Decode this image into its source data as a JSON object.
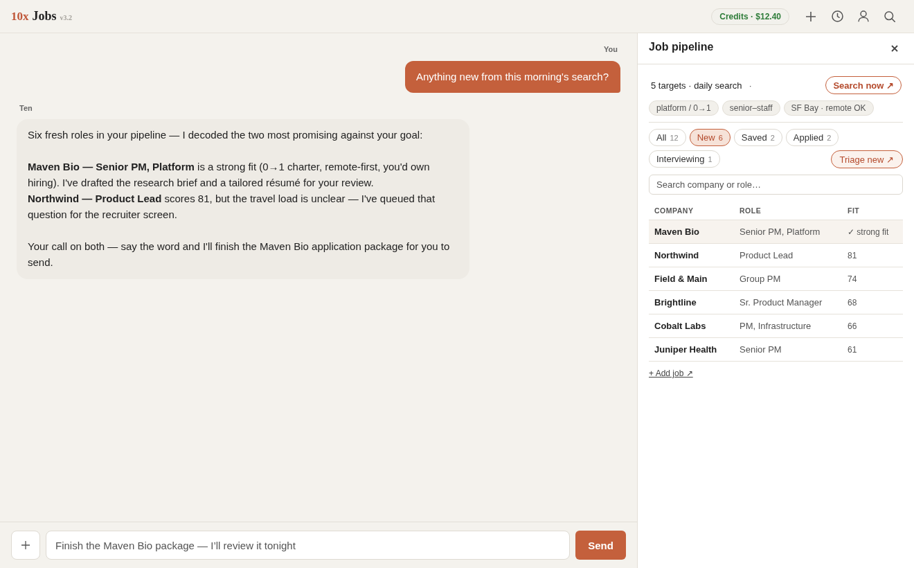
{
  "topbar": {
    "logo_mark": "10x",
    "logo_word": "Jobs",
    "version": "v3.2",
    "credits": "Credits · $12.40"
  },
  "chat": {
    "messages": [
      {
        "kind": "user",
        "author": "You",
        "paragraphs": [
          [
            "Anything new from this morning's search?"
          ]
        ]
      },
      {
        "kind": "assistant",
        "author": "Ten",
        "paragraphs": [
          [
            "Six fresh roles in your pipeline — I decoded the two most promising against your goal:"
          ],
          [
            "**Maven Bio — Senior PM, Platform** is a strong fit (0→1 charter, remote-first, you'd own hiring). I've drafted the research brief and a tailored résumé for your review.",
            "**Northwind — Product Lead** scores 81, but the travel load is unclear — I've queued that question for the recruiter screen."
          ],
          [
            "Your call on both — say the word and I'll finish the Maven Bio application package for you to send."
          ]
        ]
      }
    ]
  },
  "composer": {
    "value": "Finish the Maven Bio package — I’ll review it tonight",
    "send": "Send"
  },
  "panel": {
    "title": "Job pipeline",
    "summary": "5 targets · daily search",
    "summary_separator": "·",
    "search_now": "Search now ↗",
    "tags": [
      "platform / 0→1",
      "senior–staff",
      "SF Bay · remote OK"
    ],
    "filters": [
      {
        "label": "All",
        "count": "12",
        "selected": false
      },
      {
        "label": "New",
        "count": "6",
        "selected": true
      },
      {
        "label": "Saved",
        "count": "2",
        "selected": false
      },
      {
        "label": "Applied",
        "count": "2",
        "selected": false
      },
      {
        "label": "Interviewing",
        "count": "1",
        "selected": false
      }
    ],
    "triage": "Triage new ↗",
    "search": {
      "placeholder": "Search company or role…"
    },
    "table": {
      "columns": [
        "COMPANY",
        "ROLE",
        "FIT"
      ],
      "rows": [
        {
          "cells": [
            "Maven Bio",
            "Senior PM, Platform",
            "✓ strong fit"
          ],
          "selected": true
        },
        {
          "cells": [
            "Northwind",
            "Product Lead",
            "81"
          ],
          "selected": false
        },
        {
          "cells": [
            "Field & Main",
            "Group PM",
            "74"
          ],
          "selected": false
        },
        {
          "cells": [
            "Brightline",
            "Sr. Product Manager",
            "68"
          ],
          "selected": false
        },
        {
          "cells": [
            "Cobalt Labs",
            "PM, Infrastructure",
            "66"
          ],
          "selected": false
        },
        {
          "cells": [
            "Juniper Health",
            "Senior PM",
            "61"
          ],
          "selected": false
        }
      ]
    },
    "add_job": "+ Add job ↗"
  }
}
